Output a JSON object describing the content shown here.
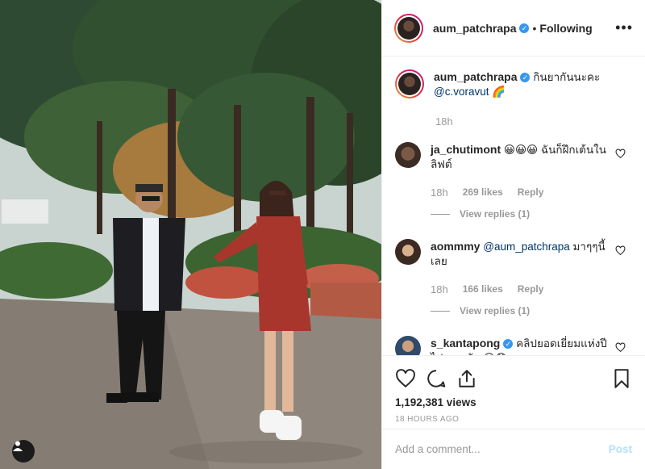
{
  "header": {
    "username": "aum_patchrapa",
    "separator": "•",
    "follow_status": "Following",
    "more": "•••"
  },
  "caption": {
    "username": "aum_patchrapa",
    "text": "กินยากันนะคะ",
    "mention": "@c.voravut",
    "emoji": "🌈",
    "time": "18h"
  },
  "comments": [
    {
      "username": "ja_chutimont",
      "emoji": "😀😀😀",
      "text": "ฉันก็ฝึกเต้นในลิฟต์",
      "time": "18h",
      "likes": "269 likes",
      "reply": "Reply",
      "view_replies": "View replies (1)"
    },
    {
      "username": "aommmy",
      "mention": "@aum_patchrapa",
      "text": "มาๆๆนี้เลย",
      "time": "18h",
      "likes": "166 likes",
      "reply": "Reply",
      "view_replies": "View replies (1)"
    },
    {
      "username": "s_kantapong",
      "text": "คลิปยอดเยี่ยมแห่งปีไปเลยครับ",
      "emoji": "😂😱"
    }
  ],
  "stats": {
    "views": "1,192,381 views",
    "ago": "18 HOURS AGO"
  },
  "composer": {
    "placeholder": "Add a comment...",
    "post": "Post"
  },
  "icons": {
    "verified": "verified-badge-icon",
    "like": "heart-icon",
    "comment": "comment-icon",
    "share": "share-icon",
    "save": "bookmark-icon",
    "user_tag": "user-tag-icon"
  },
  "colors": {
    "verified": "#3897f0",
    "link": "#003569",
    "muted": "#999999",
    "post_disabled": "#b2dffc"
  }
}
